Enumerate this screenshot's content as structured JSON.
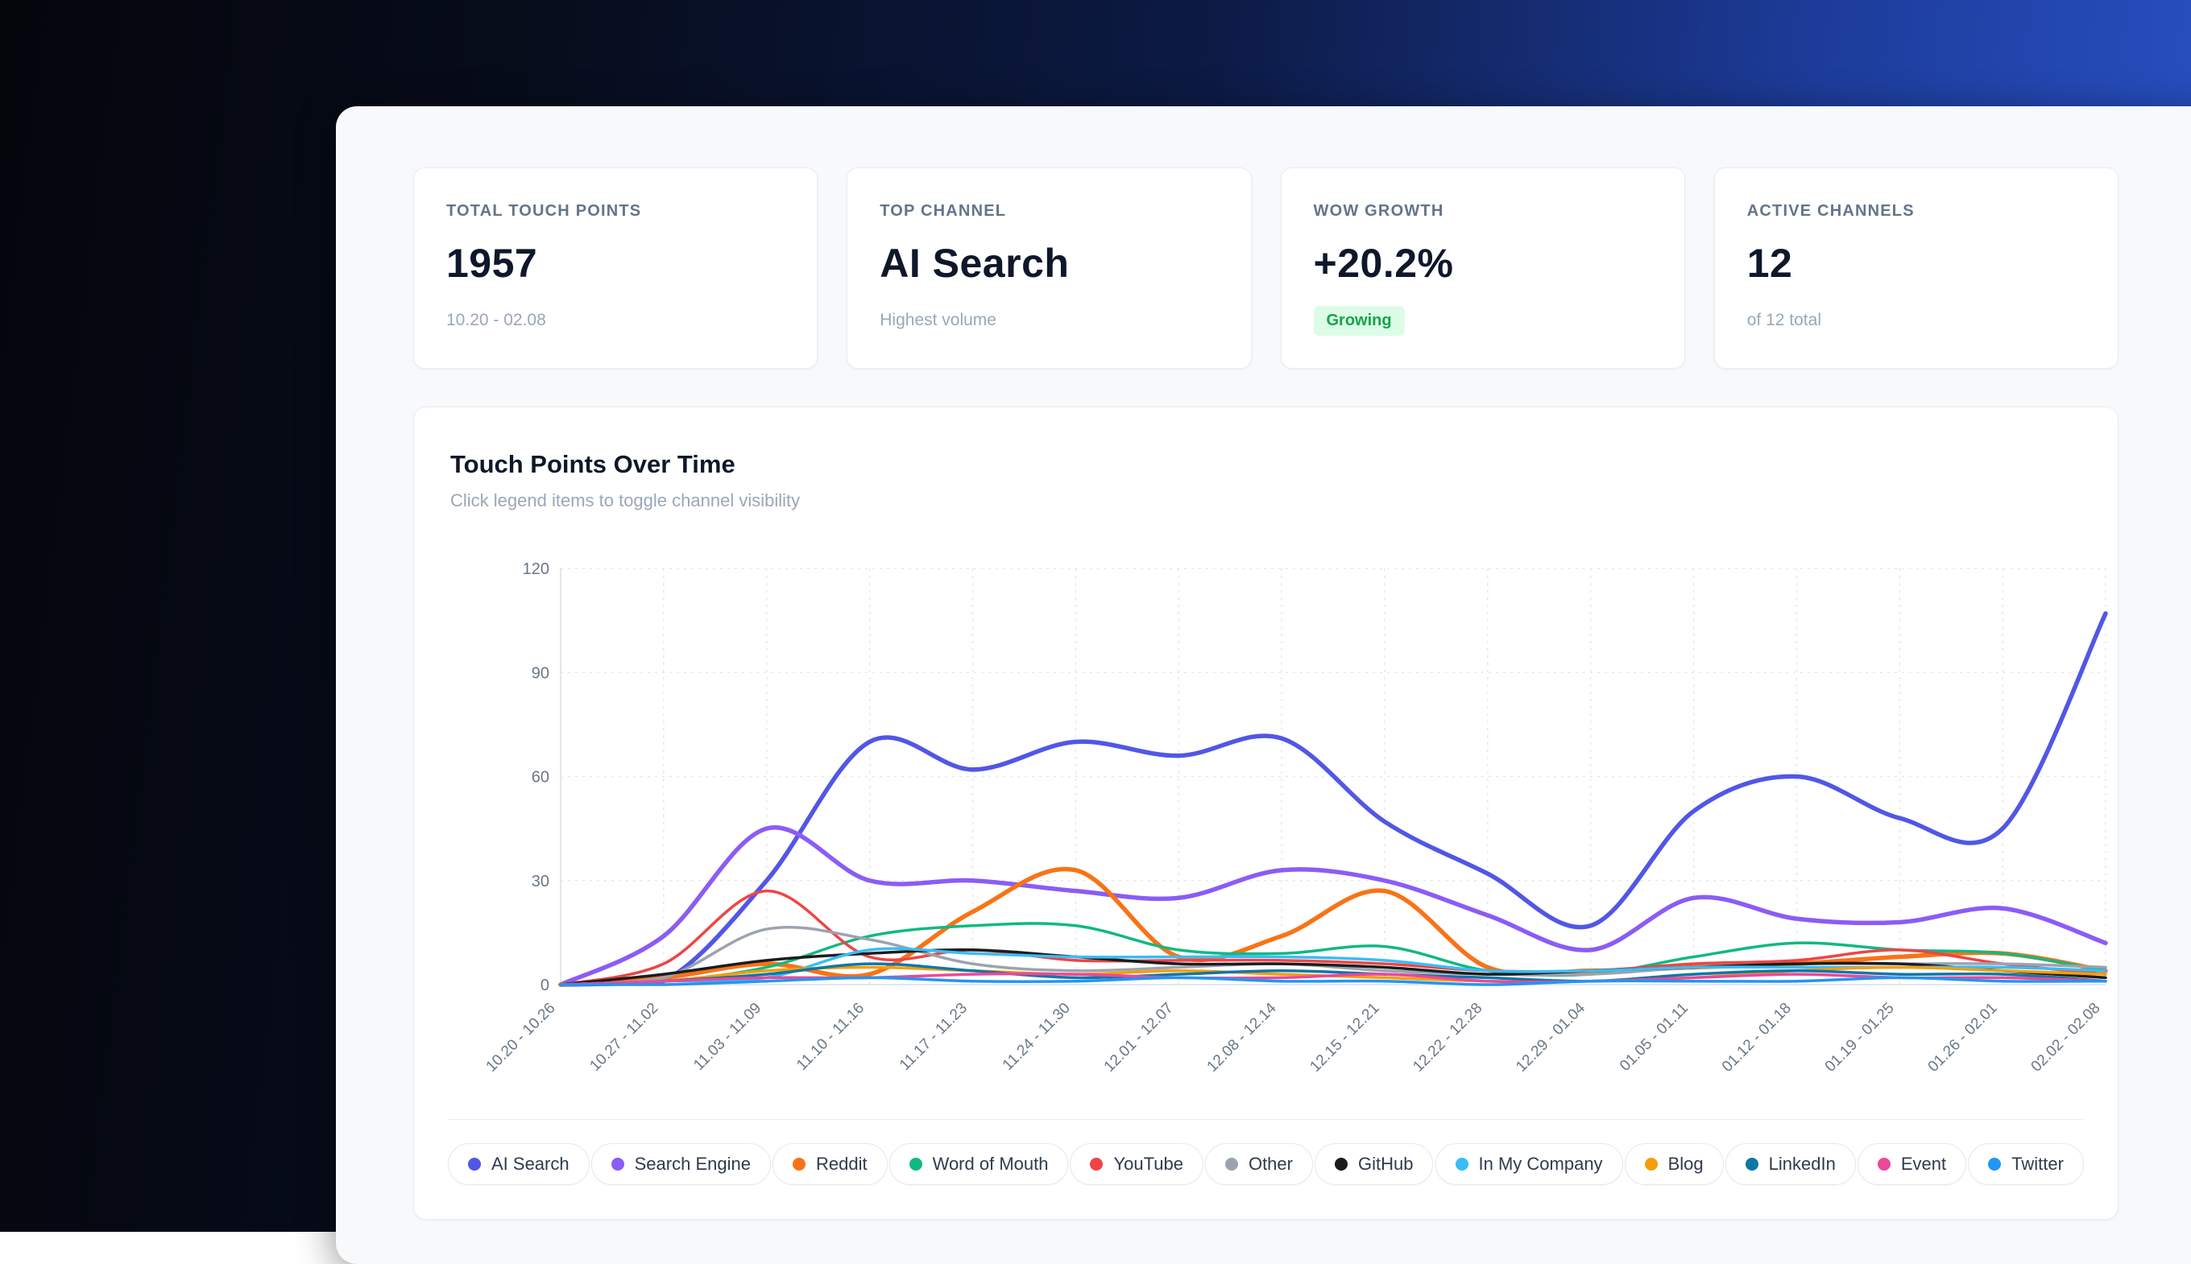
{
  "stats": [
    {
      "label": "TOTAL TOUCH POINTS",
      "value": "1957",
      "sub": "10.20 - 02.08"
    },
    {
      "label": "TOP CHANNEL",
      "value": "AI Search",
      "sub": "Highest volume"
    },
    {
      "label": "WOW GROWTH",
      "value": "+20.2%",
      "badge": "Growing"
    },
    {
      "label": "ACTIVE CHANNELS",
      "value": "12",
      "sub": "of 12 total"
    }
  ],
  "chart": {
    "title": "Touch Points Over Time",
    "subtitle": "Click legend items to toggle channel visibility"
  },
  "chart_data": {
    "type": "line",
    "title": "Touch Points Over Time",
    "xlabel": "",
    "ylabel": "",
    "ylim": [
      0,
      120
    ],
    "yticks": [
      0,
      30,
      60,
      90,
      120
    ],
    "grid": true,
    "smooth": true,
    "legend_position": "bottom",
    "categories": [
      "10.20 - 10.26",
      "10.27 - 11.02",
      "11.03 - 11.09",
      "11.10 - 11.16",
      "11.17 - 11.23",
      "11.24 - 11.30",
      "12.01 - 12.07",
      "12.08 - 12.14",
      "12.15 - 12.21",
      "12.22 - 12.28",
      "12.29 - 01.04",
      "01.05 - 01.11",
      "01.12 - 01.18",
      "01.19 - 01.25",
      "01.26 - 02.01",
      "02.02 - 02.08"
    ],
    "series": [
      {
        "name": "AI Search",
        "color": "#5157e6",
        "width": 5.5,
        "values": [
          0,
          1,
          30,
          70,
          62,
          70,
          66,
          71,
          47,
          32,
          17,
          50,
          60,
          48,
          45,
          107
        ]
      },
      {
        "name": "Search Engine",
        "color": "#8b5cf6",
        "width": 5.5,
        "values": [
          0,
          14,
          45,
          30,
          30,
          27,
          25,
          33,
          30,
          20,
          10,
          25,
          19,
          18,
          22,
          12
        ]
      },
      {
        "name": "Reddit",
        "color": "#f97316",
        "width": 5.5,
        "values": [
          0,
          2,
          6,
          3,
          21,
          33,
          8,
          14,
          27,
          5,
          4,
          5,
          6,
          8,
          9,
          4
        ]
      },
      {
        "name": "Word of Mouth",
        "color": "#10b981",
        "width": 3.5,
        "values": [
          0,
          1,
          5,
          14,
          17,
          17,
          10,
          9,
          11,
          4,
          3,
          8,
          12,
          10,
          9,
          4
        ]
      },
      {
        "name": "YouTube",
        "color": "#ef4444",
        "width": 3.5,
        "values": [
          0,
          6,
          27,
          8,
          10,
          7,
          7,
          7,
          6,
          4,
          4,
          6,
          7,
          10,
          6,
          3
        ]
      },
      {
        "name": "Other",
        "color": "#9ca3af",
        "width": 3.5,
        "values": [
          0,
          2,
          16,
          13,
          6,
          4,
          5,
          6,
          4,
          3,
          3,
          5,
          6,
          6,
          6,
          5
        ]
      },
      {
        "name": "GitHub",
        "color": "#1c1c1e",
        "width": 3.5,
        "values": [
          0,
          3,
          7,
          9,
          10,
          8,
          6,
          6,
          5,
          3,
          4,
          5,
          6,
          6,
          4,
          2
        ]
      },
      {
        "name": "In My Company",
        "color": "#38bdf8",
        "width": 3.5,
        "values": [
          0,
          1,
          2,
          10,
          9,
          8,
          8,
          8,
          7,
          4,
          4,
          5,
          5,
          5,
          5,
          4
        ]
      },
      {
        "name": "Blog",
        "color": "#f59e0b",
        "width": 3.5,
        "values": [
          0,
          1,
          4,
          5,
          4,
          3,
          4,
          3,
          2,
          1,
          1,
          2,
          4,
          5,
          4,
          3
        ]
      },
      {
        "name": "LinkedIn",
        "color": "#0e76a8",
        "width": 3.5,
        "values": [
          0,
          1,
          3,
          6,
          4,
          2,
          3,
          4,
          3,
          2,
          1,
          3,
          4,
          3,
          3,
          1
        ]
      },
      {
        "name": "Event",
        "color": "#ec4899",
        "width": 3.5,
        "values": [
          0,
          1,
          2,
          2,
          3,
          3,
          2,
          2,
          3,
          1,
          1,
          2,
          3,
          2,
          2,
          1
        ]
      },
      {
        "name": "Twitter",
        "color": "#2196f3",
        "width": 3.5,
        "values": [
          0,
          0,
          1,
          2,
          1,
          1,
          2,
          1,
          1,
          0,
          1,
          1,
          1,
          2,
          1,
          1
        ]
      }
    ],
    "axis_colors": {
      "grid": "#e3e8ef",
      "axis_line": "#d9e0e9",
      "tick_text": "#6b7785"
    }
  }
}
